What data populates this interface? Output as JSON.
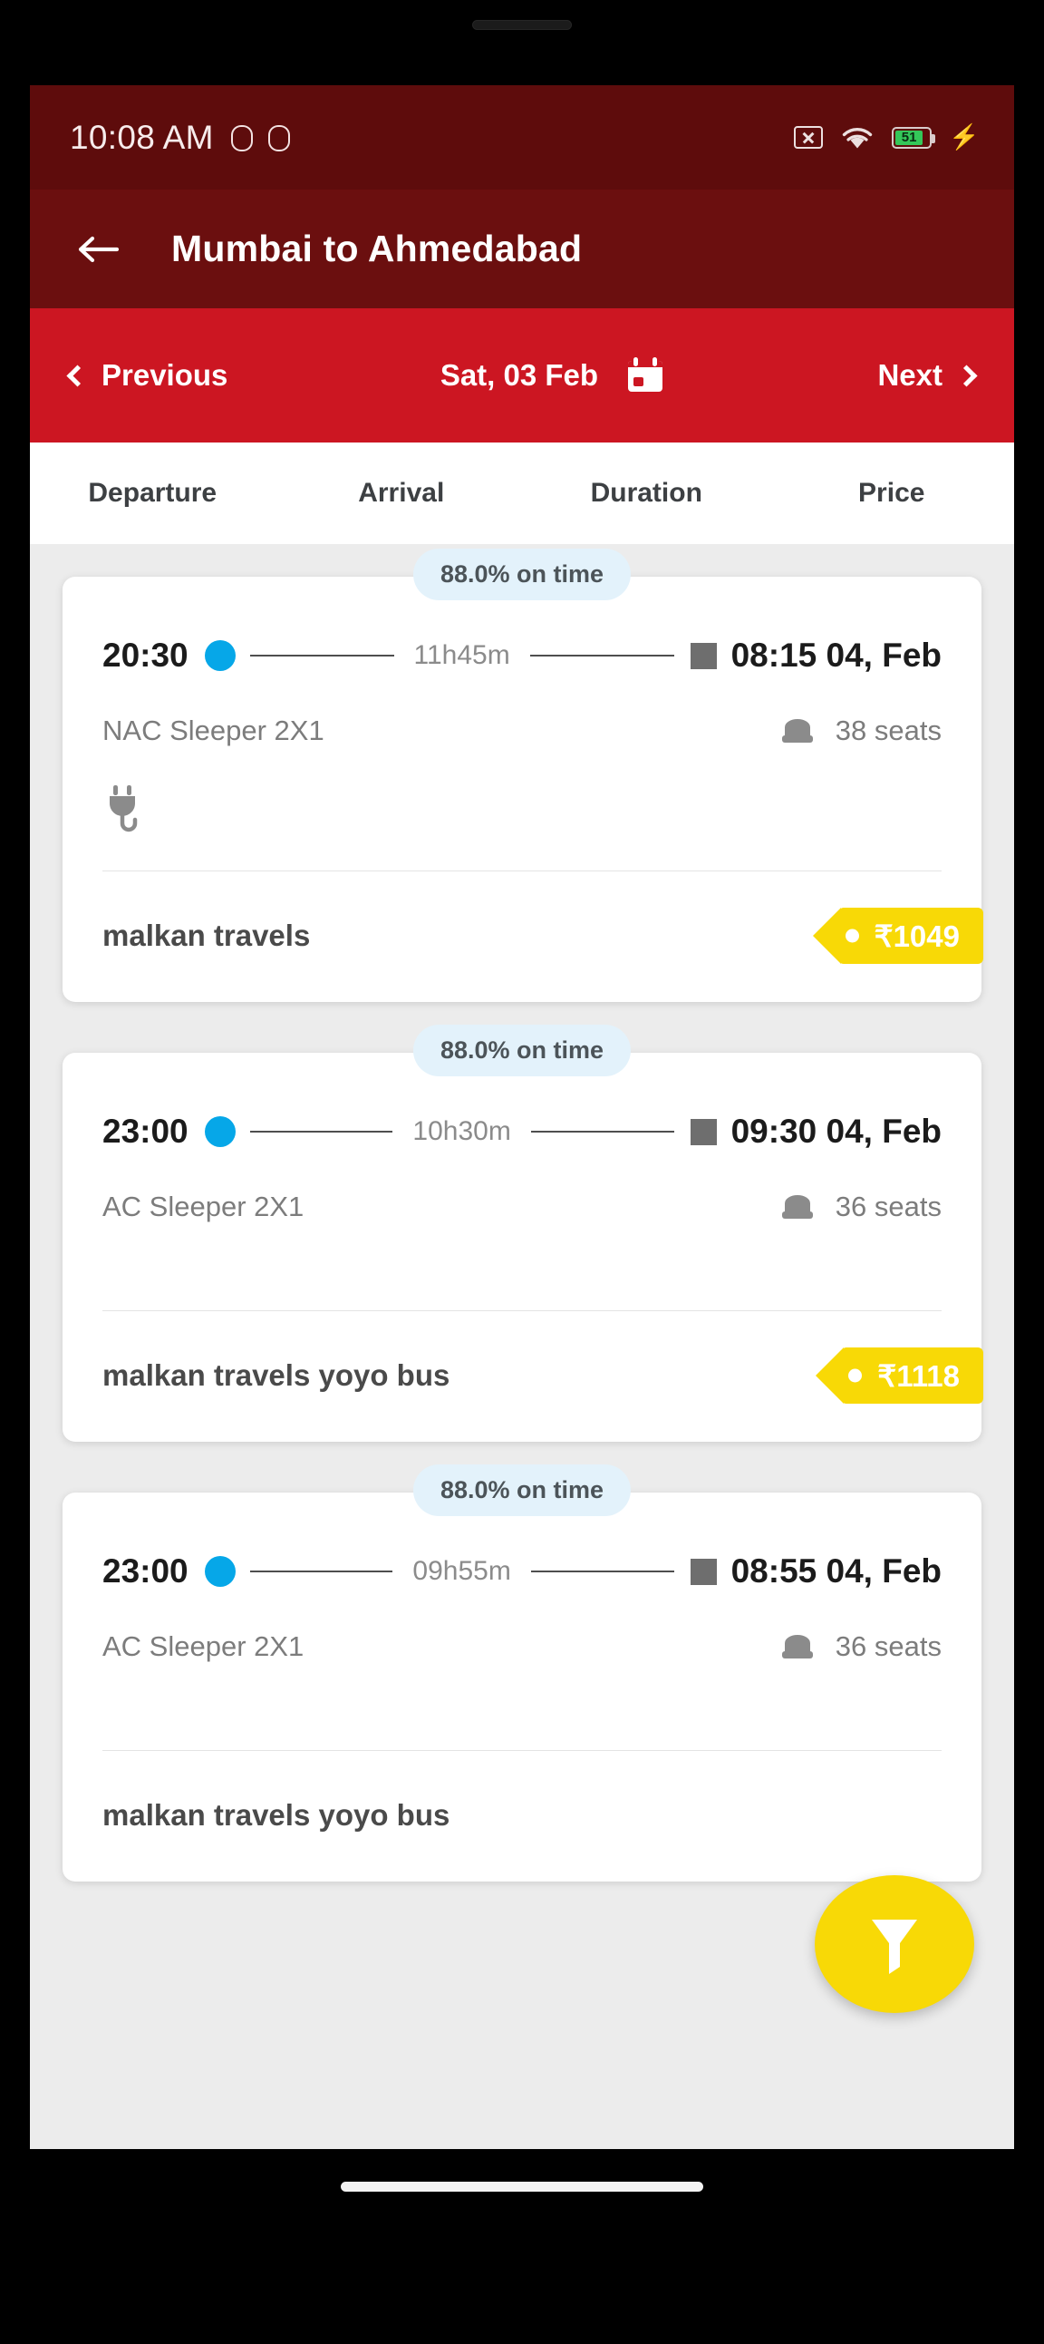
{
  "status_bar": {
    "time": "10:08 AM",
    "left_icons": [
      "android-icon",
      "android-icon"
    ],
    "right_icons": [
      "no-sim-icon",
      "wifi-icon",
      "battery-icon",
      "charging-bolt-icon"
    ],
    "battery_level": "51",
    "bg_color": "#5e0c0c"
  },
  "app_bar": {
    "back_icon": "back-arrow-icon",
    "title": "Mumbai to Ahmedabad",
    "bg_color": "#6b0f0f"
  },
  "date_nav": {
    "previous_label": "Previous",
    "date": "Sat, 03 Feb",
    "next_label": "Next",
    "calendar_icon": "calendar-icon",
    "bg_color": "#cc1622"
  },
  "column_headers": [
    "Departure",
    "Arrival",
    "Duration",
    "Price"
  ],
  "buses": [
    {
      "on_time": "88.0% on time",
      "departure": "20:30",
      "duration": "11h45m",
      "arrival": "08:15 04, Feb",
      "bus_type": "NAC Sleeper 2X1",
      "seats": "38 seats",
      "amenities": [
        "charging-plug-icon"
      ],
      "operator": "malkan travels",
      "price": "₹1049"
    },
    {
      "on_time": "88.0% on time",
      "departure": "23:00",
      "duration": "10h30m",
      "arrival": "09:30 04, Feb",
      "bus_type": "AC Sleeper 2X1",
      "seats": "36 seats",
      "amenities": [],
      "operator": "malkan travels yoyo bus",
      "price": "₹1118"
    },
    {
      "on_time": "88.0% on time",
      "departure": "23:00",
      "duration": "09h55m",
      "arrival": "08:55 04, Feb",
      "bus_type": "AC Sleeper 2X1",
      "seats": "36 seats",
      "amenities": [],
      "operator": "malkan travels yoyo bus",
      "price": ""
    }
  ],
  "fab": {
    "icon": "filter-funnel-icon",
    "color": "#f8d906"
  },
  "colors": {
    "accent_blue": "#06a7e8",
    "price_yellow": "#f8d906",
    "badge_blue": "#e3f2fb"
  }
}
